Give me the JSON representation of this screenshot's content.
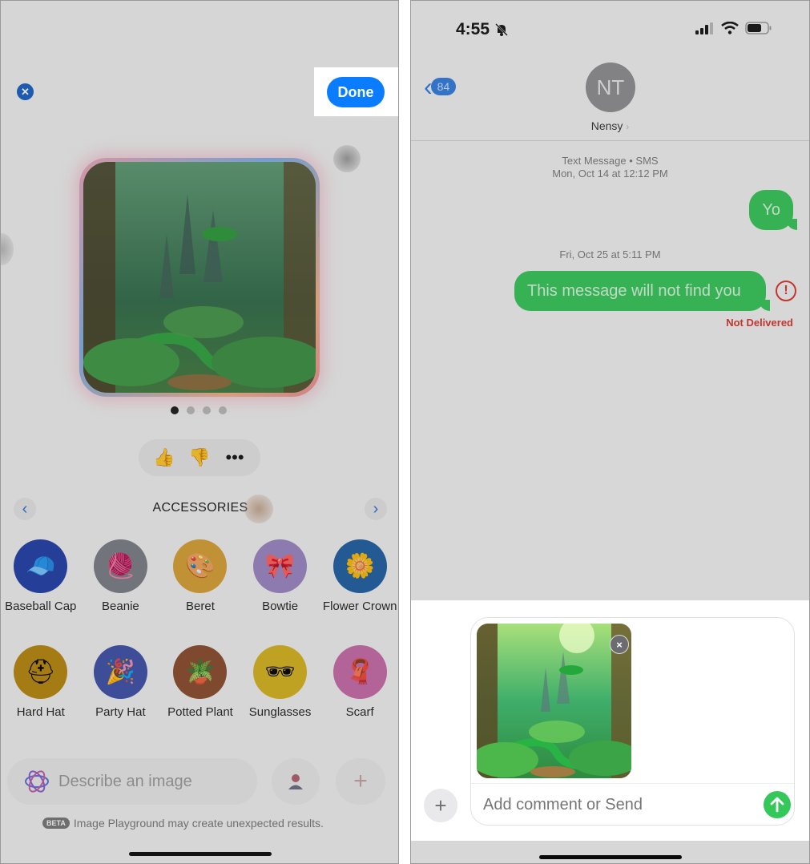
{
  "left_panel": {
    "done_label": "Done",
    "close_icon": "close-x-icon",
    "page_dots": {
      "count": 4,
      "active_index": 0
    },
    "feedback": {
      "thumbs_up": "thumbs-up-icon",
      "thumbs_down": "thumbs-down-icon",
      "more": "more-icon"
    },
    "category": {
      "title": "ACCESSORIES",
      "prev_icon": "‹",
      "next_icon": "›"
    },
    "accessories": [
      {
        "label": "Baseball Cap",
        "glyph": "🧢",
        "color": "#1f3fa8"
      },
      {
        "label": "Beanie",
        "glyph": "🧶",
        "color": "#7a7f86"
      },
      {
        "label": "Beret",
        "glyph": "🎨",
        "color": "#d9a034"
      },
      {
        "label": "Bowtie",
        "glyph": "🎀",
        "color": "#9b86c4"
      },
      {
        "label": "Flower Crown",
        "glyph": "🌼",
        "color": "#1e5fa3"
      },
      {
        "label": "Hard Hat",
        "glyph": "⛑",
        "color": "#b8860b"
      },
      {
        "label": "Party Hat",
        "glyph": "🎉",
        "color": "#3c4fa8"
      },
      {
        "label": "Potted Plant",
        "glyph": "🪴",
        "color": "#8a4a2c"
      },
      {
        "label": "Sunglasses",
        "glyph": "🕶",
        "color": "#d8b41c"
      },
      {
        "label": "Scarf",
        "glyph": "🧣",
        "color": "#c86aa8"
      }
    ],
    "prompt": {
      "placeholder": "Describe an image"
    },
    "plus_label": "+",
    "beta_badge": "BETA",
    "beta_text": "Image Playground may create unexpected results."
  },
  "right_panel": {
    "status": {
      "time": "4:55"
    },
    "back_badge": "84",
    "contact": {
      "initials": "NT",
      "name": "Nensy",
      "chevron": "›"
    },
    "thread": {
      "service": "Text Message • SMS",
      "first_timestamp": "Mon, Oct 14 at 12:12 PM",
      "second_timestamp": "Fri, Oct 25 at 5:11 PM",
      "messages": [
        {
          "text": "Yo",
          "direction": "outgoing"
        },
        {
          "text": "This message will not find you",
          "direction": "outgoing",
          "status": "Not Delivered"
        }
      ],
      "error_glyph": "!"
    },
    "compose": {
      "placeholder": "Add comment or Send",
      "attach_label": "+",
      "remove_glyph": "×"
    }
  },
  "colors": {
    "accent_blue": "#0a7cff",
    "sms_green": "#34c759",
    "error_red": "#d9342b"
  }
}
